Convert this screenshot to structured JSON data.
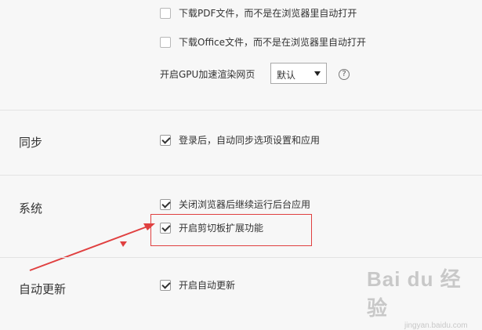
{
  "downloads": {
    "pdf_label": "下载PDF文件，而不是在浏览器里自动打开",
    "office_label": "下载Office文件，而不是在浏览器里自动打开"
  },
  "gpu": {
    "label": "开启GPU加速渲染网页",
    "select_value": "默认",
    "help_glyph": "?"
  },
  "sync": {
    "title": "同步",
    "option_label": "登录后，自动同步选项设置和应用"
  },
  "system": {
    "title": "系统",
    "option1_label": "关闭浏览器后继续运行后台应用",
    "option2_label": "开启剪切板扩展功能"
  },
  "autoupdate": {
    "title": "自动更新",
    "option_label": "开启自动更新"
  },
  "annotation": {
    "highlight_color": "#e04040"
  },
  "watermark": {
    "text": "Bai du 经验",
    "subtext": "jingyan.baidu.com"
  }
}
